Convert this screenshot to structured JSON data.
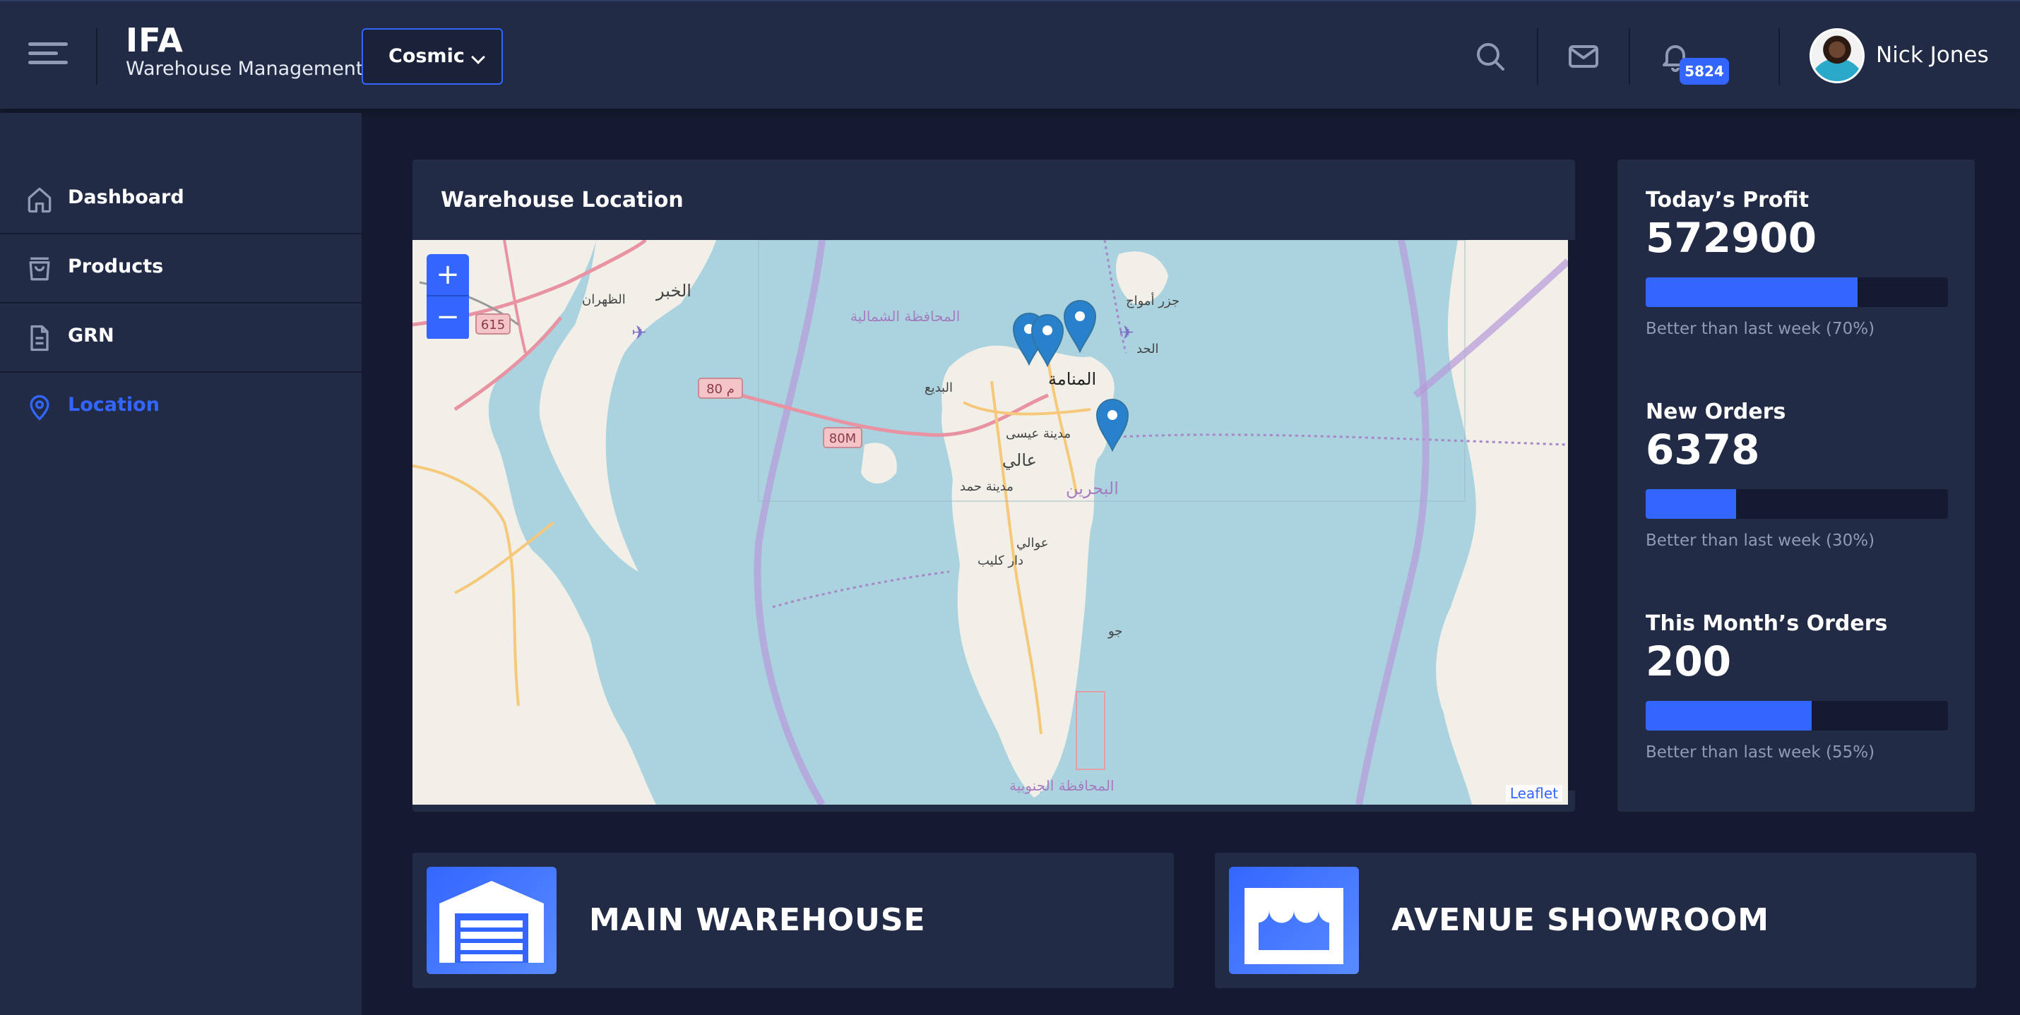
{
  "header": {
    "app_title": "IFA",
    "app_subtitle": "Warehouse Management",
    "theme_select": {
      "value": "Cosmic"
    },
    "icons": [
      "menu-icon",
      "search-icon",
      "mail-icon",
      "bell-icon"
    ],
    "notification_count": "5824",
    "user": {
      "name": "Nick Jones"
    }
  },
  "sidebar": {
    "items": [
      {
        "label": "Dashboard",
        "icon": "home-icon",
        "active": false
      },
      {
        "label": "Products",
        "icon": "shopping-bag-icon",
        "active": false
      },
      {
        "label": "GRN",
        "icon": "file-text-icon",
        "active": false
      },
      {
        "label": "Location",
        "icon": "pin-icon",
        "active": true
      }
    ]
  },
  "map_card": {
    "title": "Warehouse Location",
    "zoom_in": "+",
    "zoom_out": "−",
    "attribution": "Leaflet",
    "road_labels": [
      "615",
      "80 م",
      "80M"
    ],
    "place_labels": [
      "الخبر",
      "الظهران",
      "المحافظة الشمالية",
      "جزر أمواج",
      "الحد",
      "البديع",
      "المنامة",
      "مدينة عيسى",
      "عالي",
      "مدينة حمد",
      "البحرين",
      "عوالي",
      "دار كليب",
      "جو",
      "المحافظة الجنوبية"
    ],
    "marker_count": 4
  },
  "stats": [
    {
      "label": "Today’s Profit",
      "value": "572900",
      "progress": 0.7,
      "note": "Better than last week (70%)"
    },
    {
      "label": "New Orders",
      "value": "6378",
      "progress": 0.3,
      "note": "Better than last week (30%)"
    },
    {
      "label": "This Month’s Orders",
      "value": "200",
      "progress": 0.55,
      "note": "Better than last week (55%)"
    }
  ],
  "locations": [
    {
      "name": "MAIN WAREHOUSE",
      "icon": "warehouse-icon"
    },
    {
      "name": "AVENUE SHOWROOM",
      "icon": "storefront-icon"
    }
  ],
  "colors": {
    "background": "#151a30",
    "card": "#222b45",
    "accent": "#3366ff",
    "muted_text": "#8f9bb3",
    "water": "#aad3df",
    "land": "#f2efe9"
  }
}
